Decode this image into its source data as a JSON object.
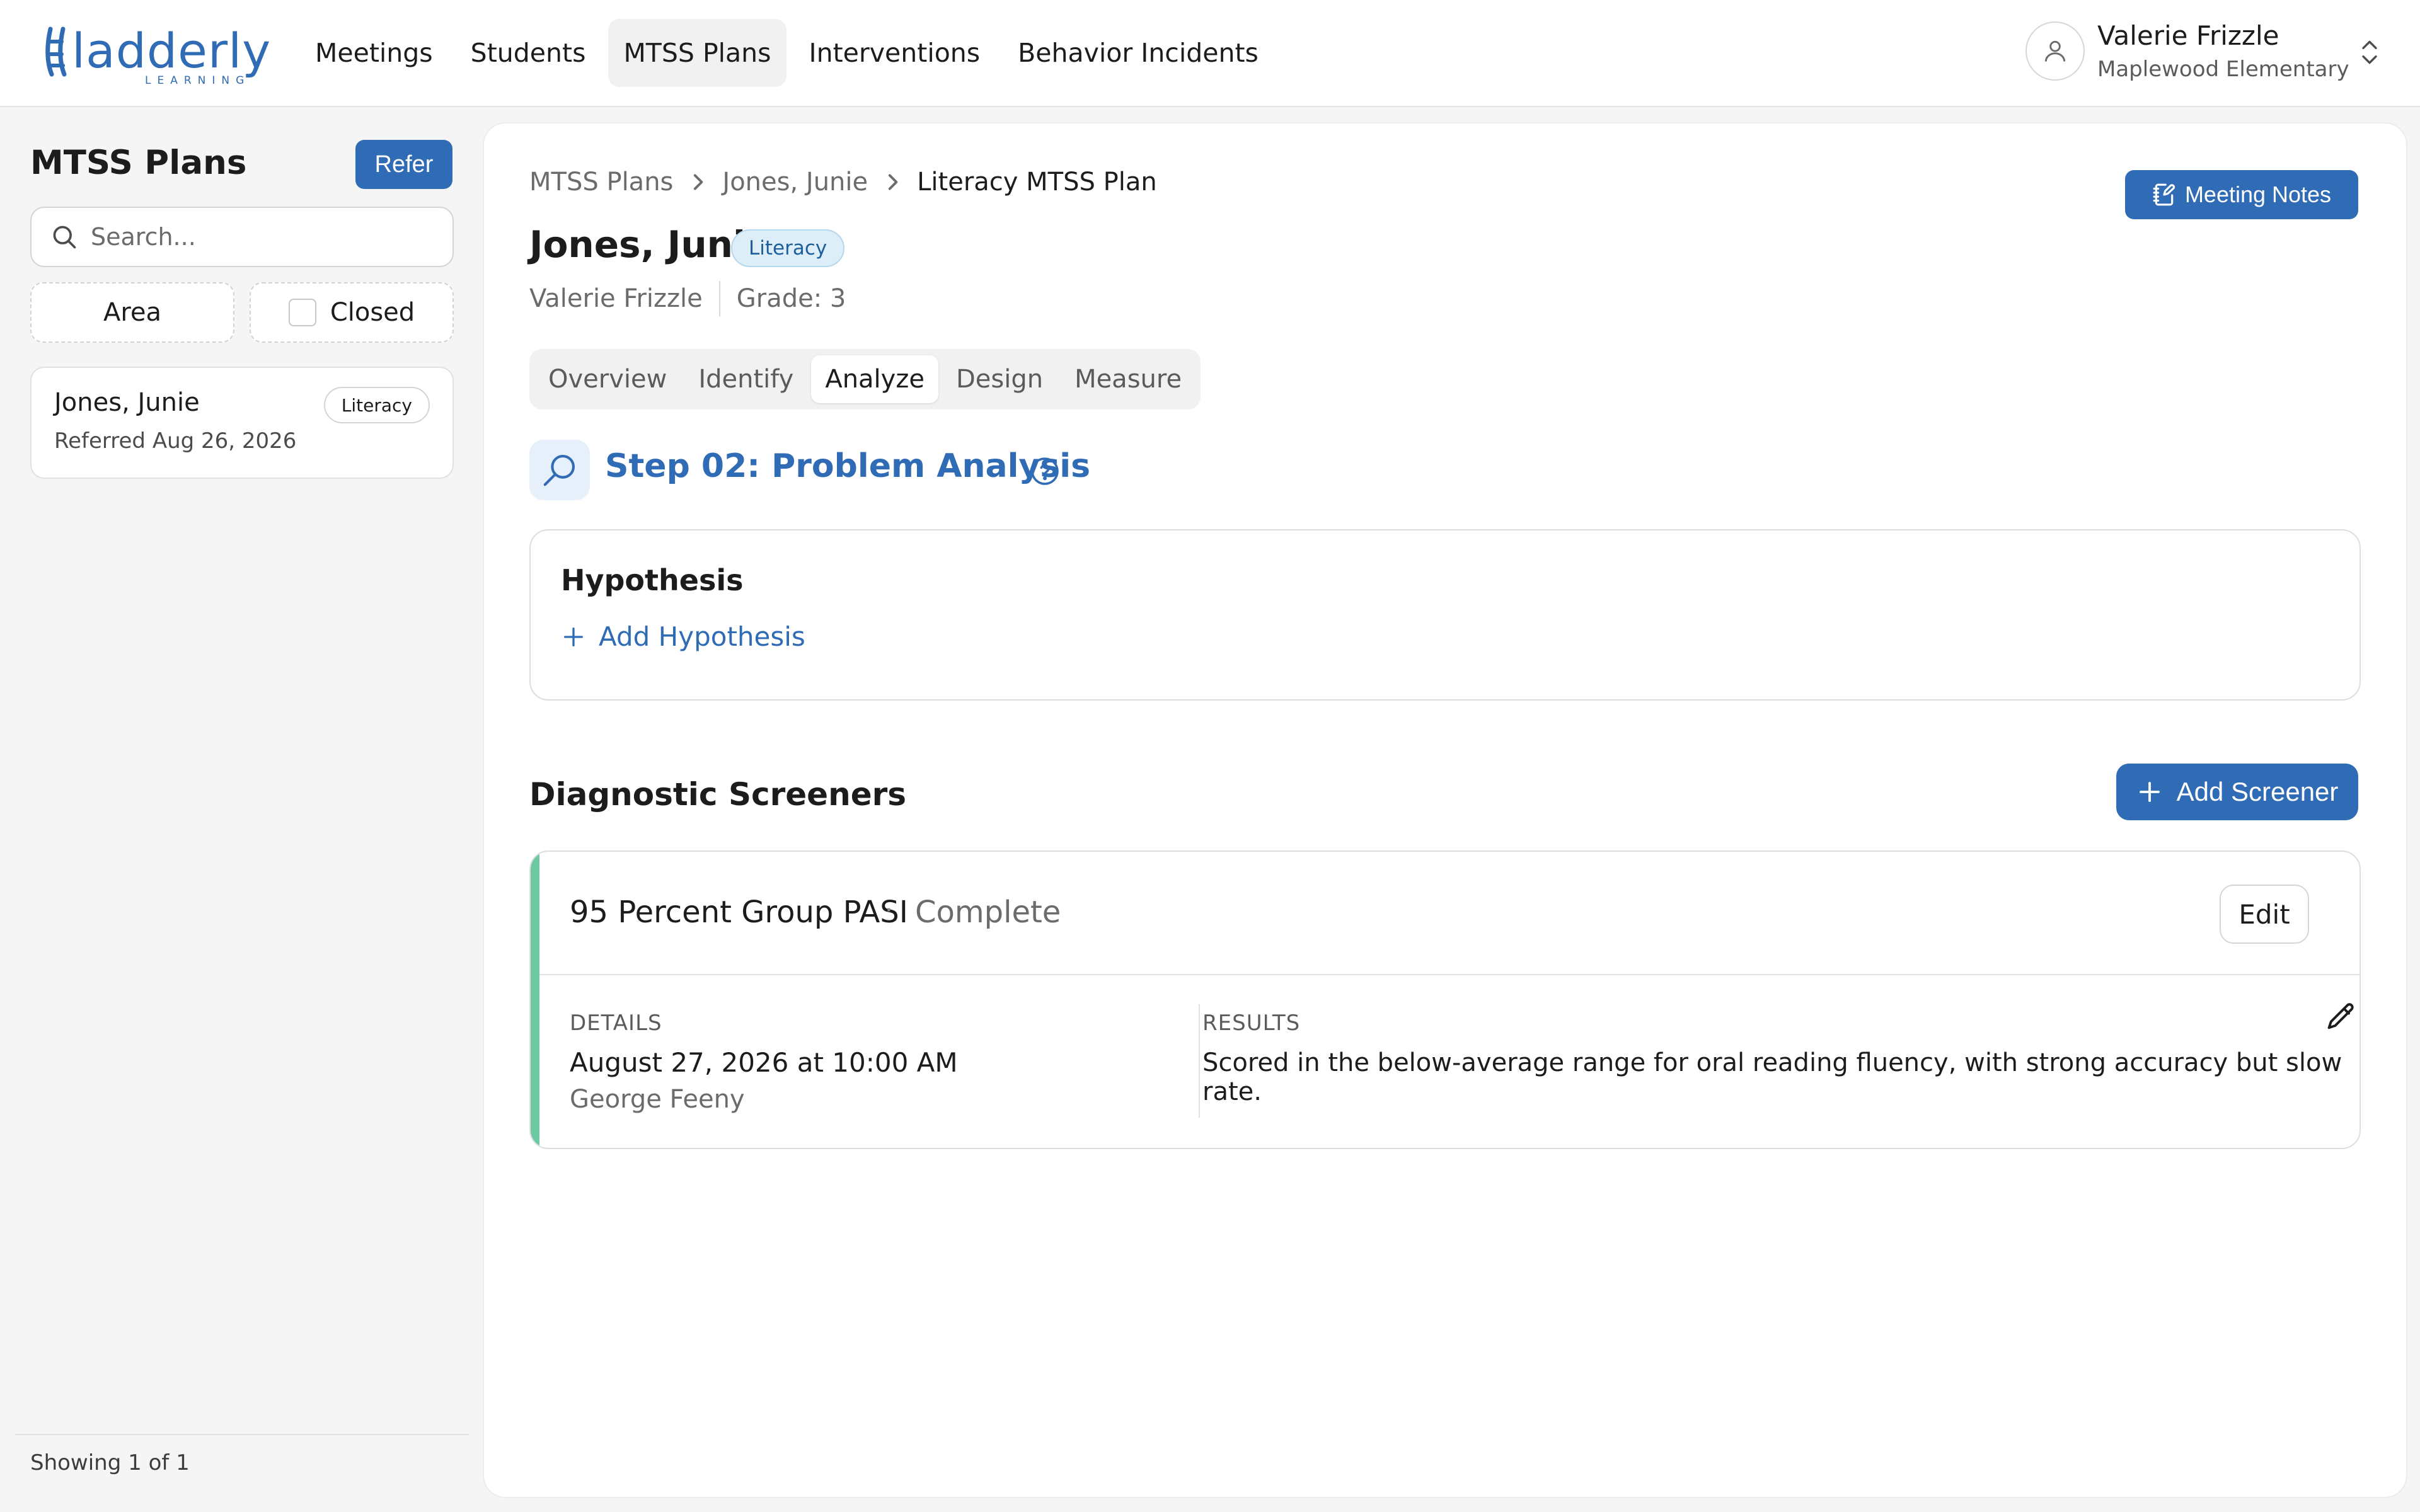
{
  "brand": {
    "name": "ladderly",
    "sub": "LEARNING"
  },
  "nav": {
    "items": [
      {
        "label": "Meetings",
        "active": false
      },
      {
        "label": "Students",
        "active": false
      },
      {
        "label": "MTSS Plans",
        "active": true
      },
      {
        "label": "Interventions",
        "active": false
      },
      {
        "label": "Behavior Incidents",
        "active": false
      }
    ]
  },
  "user": {
    "name": "Valerie Frizzle",
    "school": "Maplewood Elementary"
  },
  "sidebar": {
    "title": "MTSS Plans",
    "refer_label": "Refer",
    "search_placeholder": "Search...",
    "filters": {
      "area_label": "Area",
      "closed_label": "Closed"
    },
    "plans": [
      {
        "name": "Jones, Junie",
        "badge": "Literacy",
        "referred": "Referred Aug 26, 2026"
      }
    ],
    "footer": "Showing 1 of 1"
  },
  "main": {
    "breadcrumb": [
      "MTSS Plans",
      "Jones, Junie",
      "Literacy MTSS Plan"
    ],
    "meeting_notes_label": "Meeting Notes",
    "student": {
      "name": "Jones, Junie",
      "area": "Literacy",
      "teacher": "Valerie Frizzle",
      "grade": "Grade: 3"
    },
    "tabs": [
      {
        "label": "Overview",
        "active": false
      },
      {
        "label": "Identify",
        "active": false
      },
      {
        "label": "Analyze",
        "active": true
      },
      {
        "label": "Design",
        "active": false
      },
      {
        "label": "Measure",
        "active": false
      }
    ],
    "step_title": "Step 02: Problem Analysis",
    "hypothesis": {
      "title": "Hypothesis",
      "add_label": "Add Hypothesis"
    },
    "diagnostics": {
      "title": "Diagnostic Screeners",
      "add_label": "Add Screener",
      "screener": {
        "name": "95 Percent Group PASI",
        "separator": "·",
        "status": "Complete",
        "edit_label": "Edit",
        "details_label": "DETAILS",
        "date": "August 27, 2026 at 10:00 AM",
        "person": "George Feeny",
        "results_label": "RESULTS",
        "results_text": "Scored in the below-average range for oral reading fluency, with strong accuracy but slow rate."
      }
    }
  },
  "colors": {
    "accent": "#2f6cb5",
    "screener_accent": "#6cc9a4",
    "badge_bg": "#ddeef9"
  },
  "icons": {
    "logo": "ladder-icon",
    "user": "user-icon",
    "chevron": "chevrons-up-down-icon",
    "search": "search-icon",
    "meeting_notes": "notebook-pen-icon",
    "step": "magnifier-icon",
    "help": "help-circle-icon",
    "plus": "plus-icon",
    "pencil": "pencil-icon"
  }
}
